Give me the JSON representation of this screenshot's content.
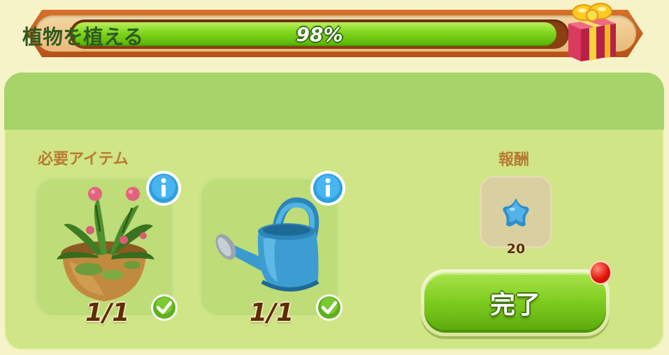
{
  "progress": {
    "percent": 98,
    "label": "98%"
  },
  "panel": {
    "title": "植物を植える",
    "required_items_label": "必要アイテム",
    "reward_label": "報酬"
  },
  "items": [
    {
      "name": "potted-plant",
      "count_label": "1/1",
      "complete": true
    },
    {
      "name": "watering-can",
      "count_label": "1/1",
      "complete": true
    }
  ],
  "reward": {
    "icon": "blue-star-icon",
    "amount": "20"
  },
  "complete_button": {
    "label": "完了",
    "has_notification": true
  },
  "colors": {
    "panel_bg": "#cfe586",
    "header_bg": "#a6d46a",
    "title_text": "#2f5a21",
    "section_label": "#b87b34",
    "progress_fill": "#7fd51c",
    "button_green": "#7ecb1f"
  }
}
